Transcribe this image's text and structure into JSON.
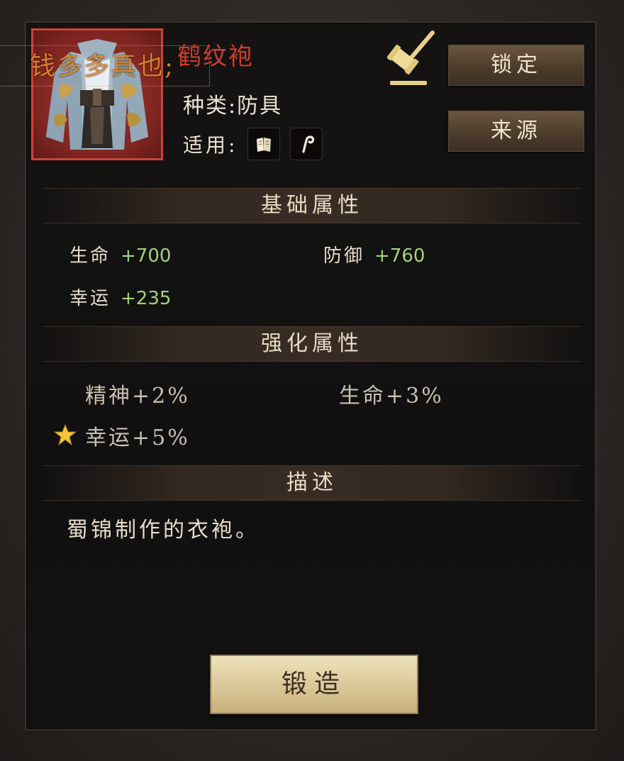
{
  "item": {
    "name": "鹤纹袍",
    "watermark": "钱多多真也;",
    "type_label": "种类:",
    "type_value": "防具",
    "usage_label": "适用:",
    "usage_icons": [
      "scroll-icon",
      "staff-icon"
    ],
    "icon": "robe-icon",
    "frame_color": "#c7453a"
  },
  "actions": {
    "lock_label": "锁定",
    "source_label": "来源",
    "forge_label": "锻造",
    "hammer_icon": "hammer-icon"
  },
  "base_attributes": {
    "title": "基础属性",
    "stats": [
      {
        "name": "生命",
        "value": "+700"
      },
      {
        "name": "防御",
        "value": "+760"
      },
      {
        "name": "幸运",
        "value": "+235"
      }
    ]
  },
  "enhanced_attributes": {
    "title": "强化属性",
    "stats": [
      {
        "text": "精神+2%"
      },
      {
        "text": "生命+3%"
      },
      {
        "text": "幸运+5%",
        "starred": true
      }
    ]
  },
  "description": {
    "title": "描述",
    "text": "蜀锦制作的衣袍。"
  },
  "colors": {
    "name": "#d23a2c",
    "stat_value": "#a7d07a",
    "watermark": "#e08a2c"
  }
}
